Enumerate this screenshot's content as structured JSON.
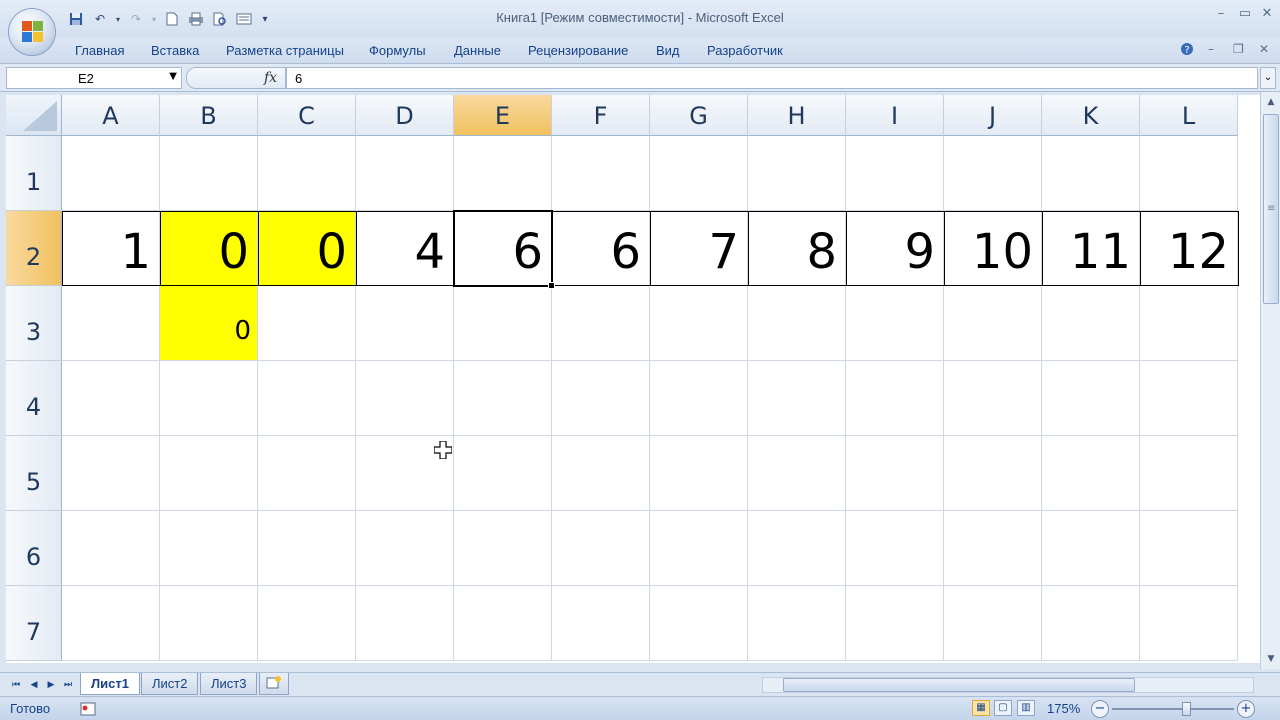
{
  "window": {
    "title": "Книга1  [Режим совместимости] - Microsoft Excel",
    "controls": [
      "minimize",
      "maximize",
      "close"
    ]
  },
  "quick_access": {
    "icons": [
      "save-icon",
      "undo-icon",
      "redo-icon",
      "new-icon",
      "print-icon",
      "print-preview-icon",
      "form-icon",
      "customize-icon"
    ]
  },
  "ribbon": {
    "tabs": [
      "Главная",
      "Вставка",
      "Разметка страницы",
      "Формулы",
      "Данные",
      "Рецензирование",
      "Вид",
      "Разработчик"
    ]
  },
  "formula_bar": {
    "name_box": "E2",
    "fx_label": "fx",
    "formula": "6"
  },
  "grid": {
    "columns": [
      "A",
      "B",
      "C",
      "D",
      "E",
      "F",
      "G",
      "H",
      "I",
      "J",
      "K",
      "L"
    ],
    "rows": [
      "1",
      "2",
      "3",
      "4",
      "5",
      "6",
      "7"
    ],
    "selected_column": "E",
    "selected_row": "2",
    "active_cell": "E2",
    "row2": [
      "1",
      "0",
      "0",
      "4",
      "6",
      "6",
      "7",
      "8",
      "9",
      "10",
      "11",
      "12"
    ],
    "b3": "0",
    "highlight_color": "#ffff00",
    "highlighted_cells": [
      "B2",
      "C2",
      "B3"
    ]
  },
  "sheets": {
    "tabs": [
      "Лист1",
      "Лист2",
      "Лист3"
    ],
    "active": "Лист1"
  },
  "status_bar": {
    "ready": "Готово",
    "zoom": "175%"
  },
  "colors": {
    "selected_header": "#f1c15f",
    "ribbon_text": "#15428b"
  }
}
